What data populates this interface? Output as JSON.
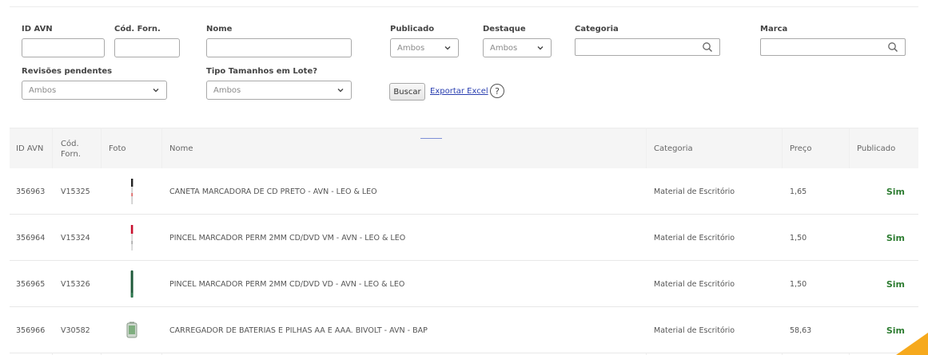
{
  "filters": {
    "id_avn": {
      "label": "ID AVN",
      "value": ""
    },
    "cod_forn": {
      "label": "Cód. Forn.",
      "value": ""
    },
    "nome": {
      "label": "Nome",
      "value": ""
    },
    "publicado": {
      "label": "Publicado",
      "value": "Ambos"
    },
    "destaque": {
      "label": "Destaque",
      "value": "Ambos"
    },
    "categoria": {
      "label": "Categoria",
      "value": ""
    },
    "marca": {
      "label": "Marca",
      "value": ""
    },
    "revisoes": {
      "label": "Revisões pendentes",
      "value": "Ambos"
    },
    "tipo_tamanhos": {
      "label": "Tipo Tamanhos em Lote?",
      "value": "Ambos"
    },
    "buscar_label": "Buscar",
    "exportar_label": "Exportar Excel",
    "help_glyph": "?"
  },
  "table": {
    "columns": {
      "id": "ID AVN",
      "cod": "Cód. Forn.",
      "foto": "Foto",
      "nome": "Nome",
      "categoria": "Categoria",
      "preco": "Preço",
      "publicado": "Publicado"
    },
    "rows": [
      {
        "id": "356963",
        "cod": "V15325",
        "nome": "CANETA MARCADORA DE CD PRETO - AVN - LEO & LEO",
        "categoria": "Material de Escritório",
        "preco": "1,65",
        "publicado": "Sim",
        "foto_icon": "black-marker-pen-icon"
      },
      {
        "id": "356964",
        "cod": "V15324",
        "nome": "PINCEL MARCADOR PERM 2MM CD/DVD VM - AVN - LEO & LEO",
        "categoria": "Material de Escritório",
        "preco": "1,50",
        "publicado": "Sim",
        "foto_icon": "red-marker-pen-icon"
      },
      {
        "id": "356965",
        "cod": "V15326",
        "nome": "PINCEL MARCADOR PERM 2MM CD/DVD VD - AVN - LEO & LEO",
        "categoria": "Material de Escritório",
        "preco": "1,50",
        "publicado": "Sim",
        "foto_icon": "green-marker-pen-icon"
      },
      {
        "id": "356966",
        "cod": "V30582",
        "nome": "CARREGADOR DE BATERIAS E PILHAS AA E AAA. BIVOLT - AVN - BAP",
        "categoria": "Material de Escritório",
        "preco": "58,63",
        "publicado": "Sim",
        "foto_icon": "battery-charger-icon"
      }
    ]
  },
  "colors": {
    "published_text": "#2e7d32",
    "link": "#2a3fb0",
    "corner_accent": "#f6a91d"
  }
}
